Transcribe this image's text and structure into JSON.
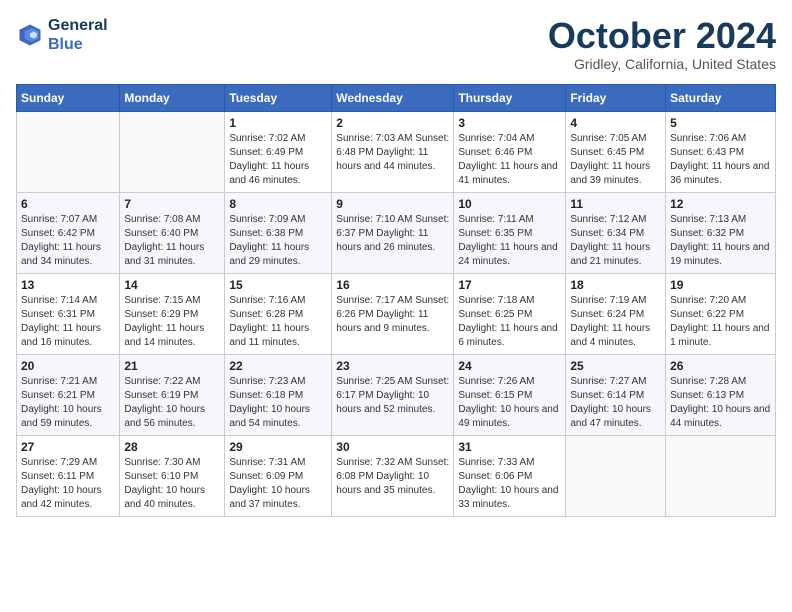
{
  "header": {
    "logo_line1": "General",
    "logo_line2": "Blue",
    "month": "October 2024",
    "location": "Gridley, California, United States"
  },
  "days_of_week": [
    "Sunday",
    "Monday",
    "Tuesday",
    "Wednesday",
    "Thursday",
    "Friday",
    "Saturday"
  ],
  "weeks": [
    [
      {
        "num": "",
        "info": ""
      },
      {
        "num": "",
        "info": ""
      },
      {
        "num": "1",
        "info": "Sunrise: 7:02 AM\nSunset: 6:49 PM\nDaylight: 11 hours and 46 minutes."
      },
      {
        "num": "2",
        "info": "Sunrise: 7:03 AM\nSunset: 6:48 PM\nDaylight: 11 hours and 44 minutes."
      },
      {
        "num": "3",
        "info": "Sunrise: 7:04 AM\nSunset: 6:46 PM\nDaylight: 11 hours and 41 minutes."
      },
      {
        "num": "4",
        "info": "Sunrise: 7:05 AM\nSunset: 6:45 PM\nDaylight: 11 hours and 39 minutes."
      },
      {
        "num": "5",
        "info": "Sunrise: 7:06 AM\nSunset: 6:43 PM\nDaylight: 11 hours and 36 minutes."
      }
    ],
    [
      {
        "num": "6",
        "info": "Sunrise: 7:07 AM\nSunset: 6:42 PM\nDaylight: 11 hours and 34 minutes."
      },
      {
        "num": "7",
        "info": "Sunrise: 7:08 AM\nSunset: 6:40 PM\nDaylight: 11 hours and 31 minutes."
      },
      {
        "num": "8",
        "info": "Sunrise: 7:09 AM\nSunset: 6:38 PM\nDaylight: 11 hours and 29 minutes."
      },
      {
        "num": "9",
        "info": "Sunrise: 7:10 AM\nSunset: 6:37 PM\nDaylight: 11 hours and 26 minutes."
      },
      {
        "num": "10",
        "info": "Sunrise: 7:11 AM\nSunset: 6:35 PM\nDaylight: 11 hours and 24 minutes."
      },
      {
        "num": "11",
        "info": "Sunrise: 7:12 AM\nSunset: 6:34 PM\nDaylight: 11 hours and 21 minutes."
      },
      {
        "num": "12",
        "info": "Sunrise: 7:13 AM\nSunset: 6:32 PM\nDaylight: 11 hours and 19 minutes."
      }
    ],
    [
      {
        "num": "13",
        "info": "Sunrise: 7:14 AM\nSunset: 6:31 PM\nDaylight: 11 hours and 16 minutes."
      },
      {
        "num": "14",
        "info": "Sunrise: 7:15 AM\nSunset: 6:29 PM\nDaylight: 11 hours and 14 minutes."
      },
      {
        "num": "15",
        "info": "Sunrise: 7:16 AM\nSunset: 6:28 PM\nDaylight: 11 hours and 11 minutes."
      },
      {
        "num": "16",
        "info": "Sunrise: 7:17 AM\nSunset: 6:26 PM\nDaylight: 11 hours and 9 minutes."
      },
      {
        "num": "17",
        "info": "Sunrise: 7:18 AM\nSunset: 6:25 PM\nDaylight: 11 hours and 6 minutes."
      },
      {
        "num": "18",
        "info": "Sunrise: 7:19 AM\nSunset: 6:24 PM\nDaylight: 11 hours and 4 minutes."
      },
      {
        "num": "19",
        "info": "Sunrise: 7:20 AM\nSunset: 6:22 PM\nDaylight: 11 hours and 1 minute."
      }
    ],
    [
      {
        "num": "20",
        "info": "Sunrise: 7:21 AM\nSunset: 6:21 PM\nDaylight: 10 hours and 59 minutes."
      },
      {
        "num": "21",
        "info": "Sunrise: 7:22 AM\nSunset: 6:19 PM\nDaylight: 10 hours and 56 minutes."
      },
      {
        "num": "22",
        "info": "Sunrise: 7:23 AM\nSunset: 6:18 PM\nDaylight: 10 hours and 54 minutes."
      },
      {
        "num": "23",
        "info": "Sunrise: 7:25 AM\nSunset: 6:17 PM\nDaylight: 10 hours and 52 minutes."
      },
      {
        "num": "24",
        "info": "Sunrise: 7:26 AM\nSunset: 6:15 PM\nDaylight: 10 hours and 49 minutes."
      },
      {
        "num": "25",
        "info": "Sunrise: 7:27 AM\nSunset: 6:14 PM\nDaylight: 10 hours and 47 minutes."
      },
      {
        "num": "26",
        "info": "Sunrise: 7:28 AM\nSunset: 6:13 PM\nDaylight: 10 hours and 44 minutes."
      }
    ],
    [
      {
        "num": "27",
        "info": "Sunrise: 7:29 AM\nSunset: 6:11 PM\nDaylight: 10 hours and 42 minutes."
      },
      {
        "num": "28",
        "info": "Sunrise: 7:30 AM\nSunset: 6:10 PM\nDaylight: 10 hours and 40 minutes."
      },
      {
        "num": "29",
        "info": "Sunrise: 7:31 AM\nSunset: 6:09 PM\nDaylight: 10 hours and 37 minutes."
      },
      {
        "num": "30",
        "info": "Sunrise: 7:32 AM\nSunset: 6:08 PM\nDaylight: 10 hours and 35 minutes."
      },
      {
        "num": "31",
        "info": "Sunrise: 7:33 AM\nSunset: 6:06 PM\nDaylight: 10 hours and 33 minutes."
      },
      {
        "num": "",
        "info": ""
      },
      {
        "num": "",
        "info": ""
      }
    ]
  ]
}
